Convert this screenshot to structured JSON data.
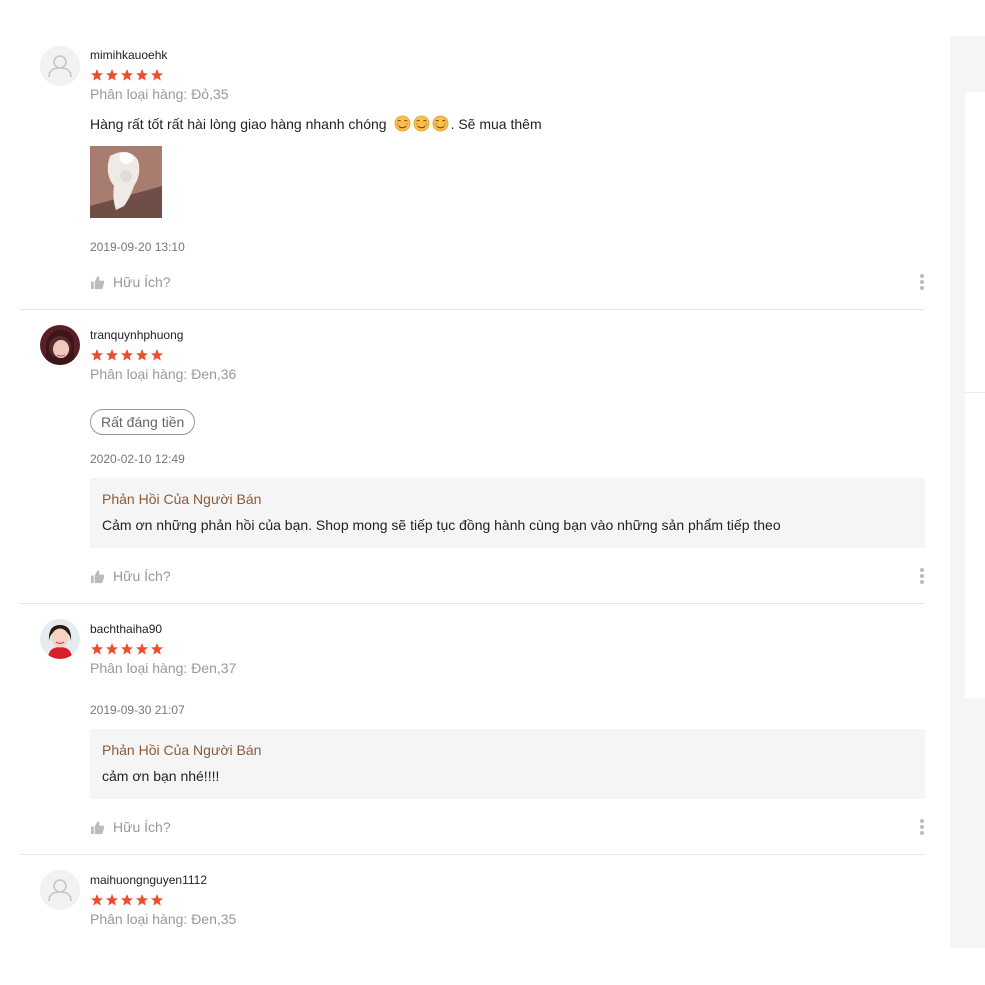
{
  "colors": {
    "star": "#ee4d2d",
    "reply_title": "#8a5a3a",
    "muted": "#999999",
    "divider": "#e6e6e6"
  },
  "reviews": [
    {
      "username": "mimihkauoehk",
      "rating": 5,
      "variation": "Phân loại hàng: Đỏ,35",
      "comment": "Hàng rất tốt rất hài lòng giao hàng nhanh chóng",
      "comment_emojis": [
        "smiling-face-with-hearts",
        "smiling-face-with-hearts",
        "smiling-face-with-hearts"
      ],
      "comment_suffix": ". Sẽ mua thêm",
      "time": "2019-09-20 13:10",
      "helpful_label": "Hữu Ích?"
    },
    {
      "username": "tranquynhphuong",
      "rating": 5,
      "variation": "Phân loại hàng: Đen,36",
      "tag": "Rất đáng tiền",
      "time": "2020-02-10 12:49",
      "reply_title": "Phản Hồi Của Người Bán",
      "reply_text": "Cảm ơn những phản hồi của bạn. Shop mong sẽ tiếp tục đồng hành cùng bạn vào những sản phẩm tiếp theo",
      "helpful_label": "Hữu Ích?"
    },
    {
      "username": "bachthaiha90",
      "rating": 5,
      "variation": "Phân loại hàng: Đen,37",
      "time": "2019-09-30 21:07",
      "reply_title": "Phản Hồi Của Người Bán",
      "reply_text": "cảm ơn bạn nhé!!!!",
      "helpful_label": "Hữu Ích?"
    },
    {
      "username": "maihuongnguyen1112",
      "rating": 5,
      "variation": "Phân loại hàng: Đen,35"
    }
  ]
}
